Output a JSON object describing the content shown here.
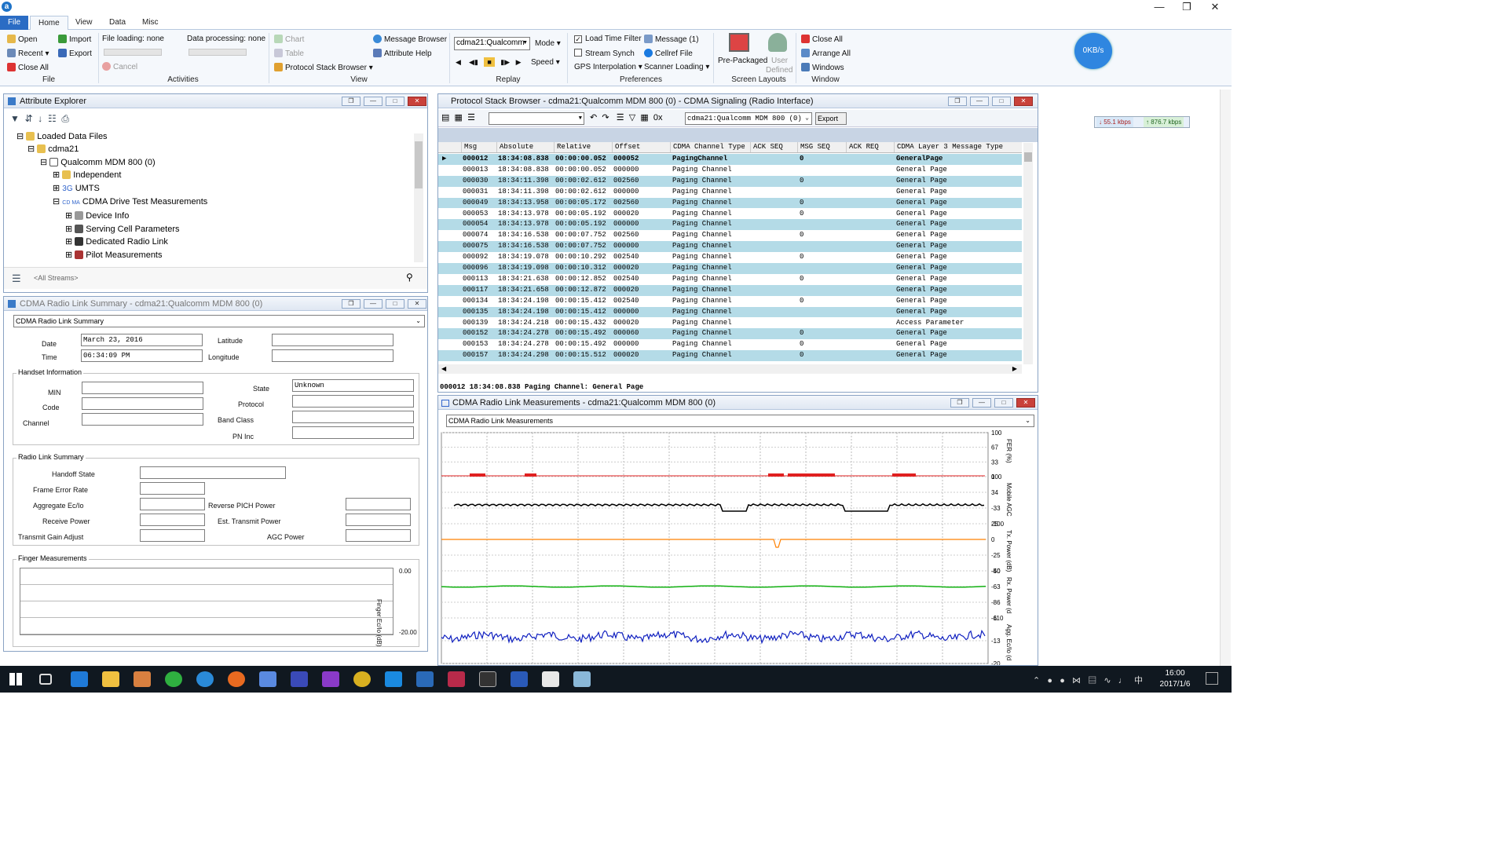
{
  "title_bar": {
    "logo": "a"
  },
  "tabs": [
    "File",
    "Home",
    "View",
    "Data",
    "Misc"
  ],
  "ribbon": {
    "file": {
      "open": "Open",
      "recent": "Recent",
      "close_all": "Close All",
      "import": "Import",
      "export": "Export",
      "group": "File"
    },
    "activities": {
      "file_loading": "File loading: none",
      "data_processing": "Data processing: none",
      "cancel": "Cancel",
      "group": "Activities"
    },
    "view": {
      "chart": "Chart",
      "table": "Table",
      "protocol_stack_browser": "Protocol Stack Browser",
      "message_browser": "Message Browser",
      "attribute_help": "Attribute Help",
      "group": "View"
    },
    "replay": {
      "stream": "cdma21:Qualcomm",
      "mode": "Mode",
      "speed": "Speed",
      "group": "Replay"
    },
    "preferences": {
      "load_time_filter": "Load Time Filter",
      "stream_synch": "Stream Synch",
      "gps_interpolation": "GPS Interpolation",
      "message": "Message (1)",
      "cellref_file": "Cellref File",
      "scanner_loading": "Scanner Loading",
      "group": "Preferences"
    },
    "screen_layouts": {
      "pre_packaged": "Pre-Packaged",
      "user": "User",
      "defined": "Defined",
      "group": "Screen Layouts"
    },
    "window": {
      "close_all": "Close All",
      "arrange_all": "Arrange All",
      "windows": "Windows",
      "group": "Window"
    },
    "speed_badge": "0KB/s"
  },
  "attribute_explorer": {
    "title": "Attribute Explorer",
    "tree": [
      "Loaded Data Files",
      "cdma21",
      "Qualcomm MDM 800 (0)",
      "Independent",
      "UMTS",
      "CDMA Drive Test Measurements",
      "Device Info",
      "Serving Cell Parameters",
      "Dedicated Radio Link",
      "Pilot Measurements"
    ],
    "umts_prefix": "3G",
    "cdma_prefix": "CD MA",
    "stream_filter": "<All Streams>"
  },
  "radio_link_summary": {
    "title": "CDMA Radio Link Summary - cdma21:Qualcomm MDM 800 (0)",
    "dropdown": "CDMA Radio Link Summary",
    "date_label": "Date",
    "date": "March 23, 2016",
    "time_label": "Time",
    "time": "06:34:09 PM",
    "latitude_label": "Latitude",
    "longitude_label": "Longitude",
    "handset_title": "Handset Information",
    "min_label": "MIN",
    "code_label": "Code",
    "channel_label": "Channel",
    "state_label": "State",
    "state": "Unknown",
    "protocol_label": "Protocol",
    "band_class_label": "Band Class",
    "pn_inc_label": "PN Inc",
    "radio_title": "Radio Link Summary",
    "handoff_label": "Handoff State",
    "fer_label": "Frame Error Rate",
    "ecio_label": "Aggregate Ec/Io",
    "rx_label": "Receive Power",
    "tga_label": "Transmit Gain Adjust",
    "rpich_label": "Reverse PICH Power",
    "etp_label": "Est. Transmit Power",
    "agc_label": "AGC Power",
    "finger_title": "Finger Measurements",
    "finger_axis": "Finger Ec/Io (dB)",
    "finger_top": "0.00",
    "finger_bottom": "-20.00"
  },
  "protocol_browser": {
    "title": "Protocol Stack Browser  -  cdma21:Qualcomm MDM 800 (0) - CDMA Signaling (Radio Interface)",
    "stream": "cdma21:Qualcomm MDM 800 (0)",
    "export": "Export",
    "hex_toggle": "0x",
    "columns": [
      "Msg",
      "Absolute",
      "Relative",
      "Offset",
      "CDMA Channel Type",
      "ACK SEQ",
      "MSG SEQ",
      "ACK REQ",
      "CDMA Layer 3 Message Type"
    ],
    "rows": [
      [
        "000012",
        "18:34:08.838",
        "00:00:00.052",
        "000052",
        "PagingChannel",
        "",
        "0",
        "",
        "GeneralPage"
      ],
      [
        "000013",
        "18:34:08.838",
        "00:00:00.052",
        "000000",
        "Paging Channel",
        "",
        "",
        "",
        "General Page"
      ],
      [
        "000030",
        "18:34:11.398",
        "00:00:02.612",
        "002560",
        "Paging Channel",
        "",
        "0",
        "",
        "General Page"
      ],
      [
        "000031",
        "18:34:11.398",
        "00:00:02.612",
        "000000",
        "Paging Channel",
        "",
        "",
        "",
        "General Page"
      ],
      [
        "000049",
        "18:34:13.958",
        "00:00:05.172",
        "002560",
        "Paging Channel",
        "",
        "0",
        "",
        "General Page"
      ],
      [
        "000053",
        "18:34:13.978",
        "00:00:05.192",
        "000020",
        "Paging Channel",
        "",
        "0",
        "",
        "General Page"
      ],
      [
        "000054",
        "18:34:13.978",
        "00:00:05.192",
        "000000",
        "Paging Channel",
        "",
        "",
        "",
        "General Page"
      ],
      [
        "000074",
        "18:34:16.538",
        "00:00:07.752",
        "002560",
        "Paging Channel",
        "",
        "0",
        "",
        "General Page"
      ],
      [
        "000075",
        "18:34:16.538",
        "00:00:07.752",
        "000000",
        "Paging Channel",
        "",
        "",
        "",
        "General Page"
      ],
      [
        "000092",
        "18:34:19.078",
        "00:00:10.292",
        "002540",
        "Paging Channel",
        "",
        "0",
        "",
        "General Page"
      ],
      [
        "000096",
        "18:34:19.098",
        "00:00:10.312",
        "000020",
        "Paging Channel",
        "",
        "",
        "",
        "General Page"
      ],
      [
        "000113",
        "18:34:21.638",
        "00:00:12.852",
        "002540",
        "Paging Channel",
        "",
        "0",
        "",
        "General Page"
      ],
      [
        "000117",
        "18:34:21.658",
        "00:00:12.872",
        "000020",
        "Paging Channel",
        "",
        "",
        "",
        "General Page"
      ],
      [
        "000134",
        "18:34:24.198",
        "00:00:15.412",
        "002540",
        "Paging Channel",
        "",
        "0",
        "",
        "General Page"
      ],
      [
        "000135",
        "18:34:24.198",
        "00:00:15.412",
        "000000",
        "Paging Channel",
        "",
        "",
        "",
        "General Page"
      ],
      [
        "000139",
        "18:34:24.218",
        "00:00:15.432",
        "000020",
        "Paging Channel",
        "",
        "",
        "",
        "Access Parameter"
      ],
      [
        "000152",
        "18:34:24.278",
        "00:00:15.492",
        "000060",
        "Paging Channel",
        "",
        "0",
        "",
        "General Page"
      ],
      [
        "000153",
        "18:34:24.278",
        "00:00:15.492",
        "000000",
        "Paging Channel",
        "",
        "0",
        "",
        "General Page"
      ],
      [
        "000157",
        "18:34:24.298",
        "00:00:15.512",
        "000020",
        "Paging Channel",
        "",
        "0",
        "",
        "General Page"
      ]
    ],
    "detail": "000012 18:34:08.838 Paging Channel: General Page"
  },
  "throughput": {
    "down": "55.1 kbps",
    "up": "876.7 kbps"
  },
  "measurements": {
    "title": "CDMA Radio Link Measurements - cdma21:Qualcomm MDM 800 (0)",
    "dropdown": "CDMA Radio Link Measurements",
    "axes": [
      {
        "name": "FER (%)",
        "ticks": [
          "100",
          "67",
          "33",
          "0"
        ]
      },
      {
        "name": "Mobile AGC",
        "ticks": [
          "100",
          "34",
          "-33",
          "-100"
        ]
      },
      {
        "name": "Tx. Power (dB)",
        "ticks": [
          "25",
          "0",
          "-25",
          "-50"
        ]
      },
      {
        "name": "Rx. Power (d",
        "ticks": [
          "-40",
          "-63",
          "-86",
          "-110"
        ]
      },
      {
        "name": "Agg. Ec/Io (d",
        "ticks": [
          "-6",
          "-13",
          "-20"
        ]
      }
    ],
    "series_colors": {
      "fer": "#e02020",
      "agc": "#000000",
      "tx": "#ff8000",
      "rx": "#10b010",
      "ecio": "#1020c0"
    }
  },
  "taskbar": {
    "time": "16:00",
    "date": "2017/1/6"
  }
}
